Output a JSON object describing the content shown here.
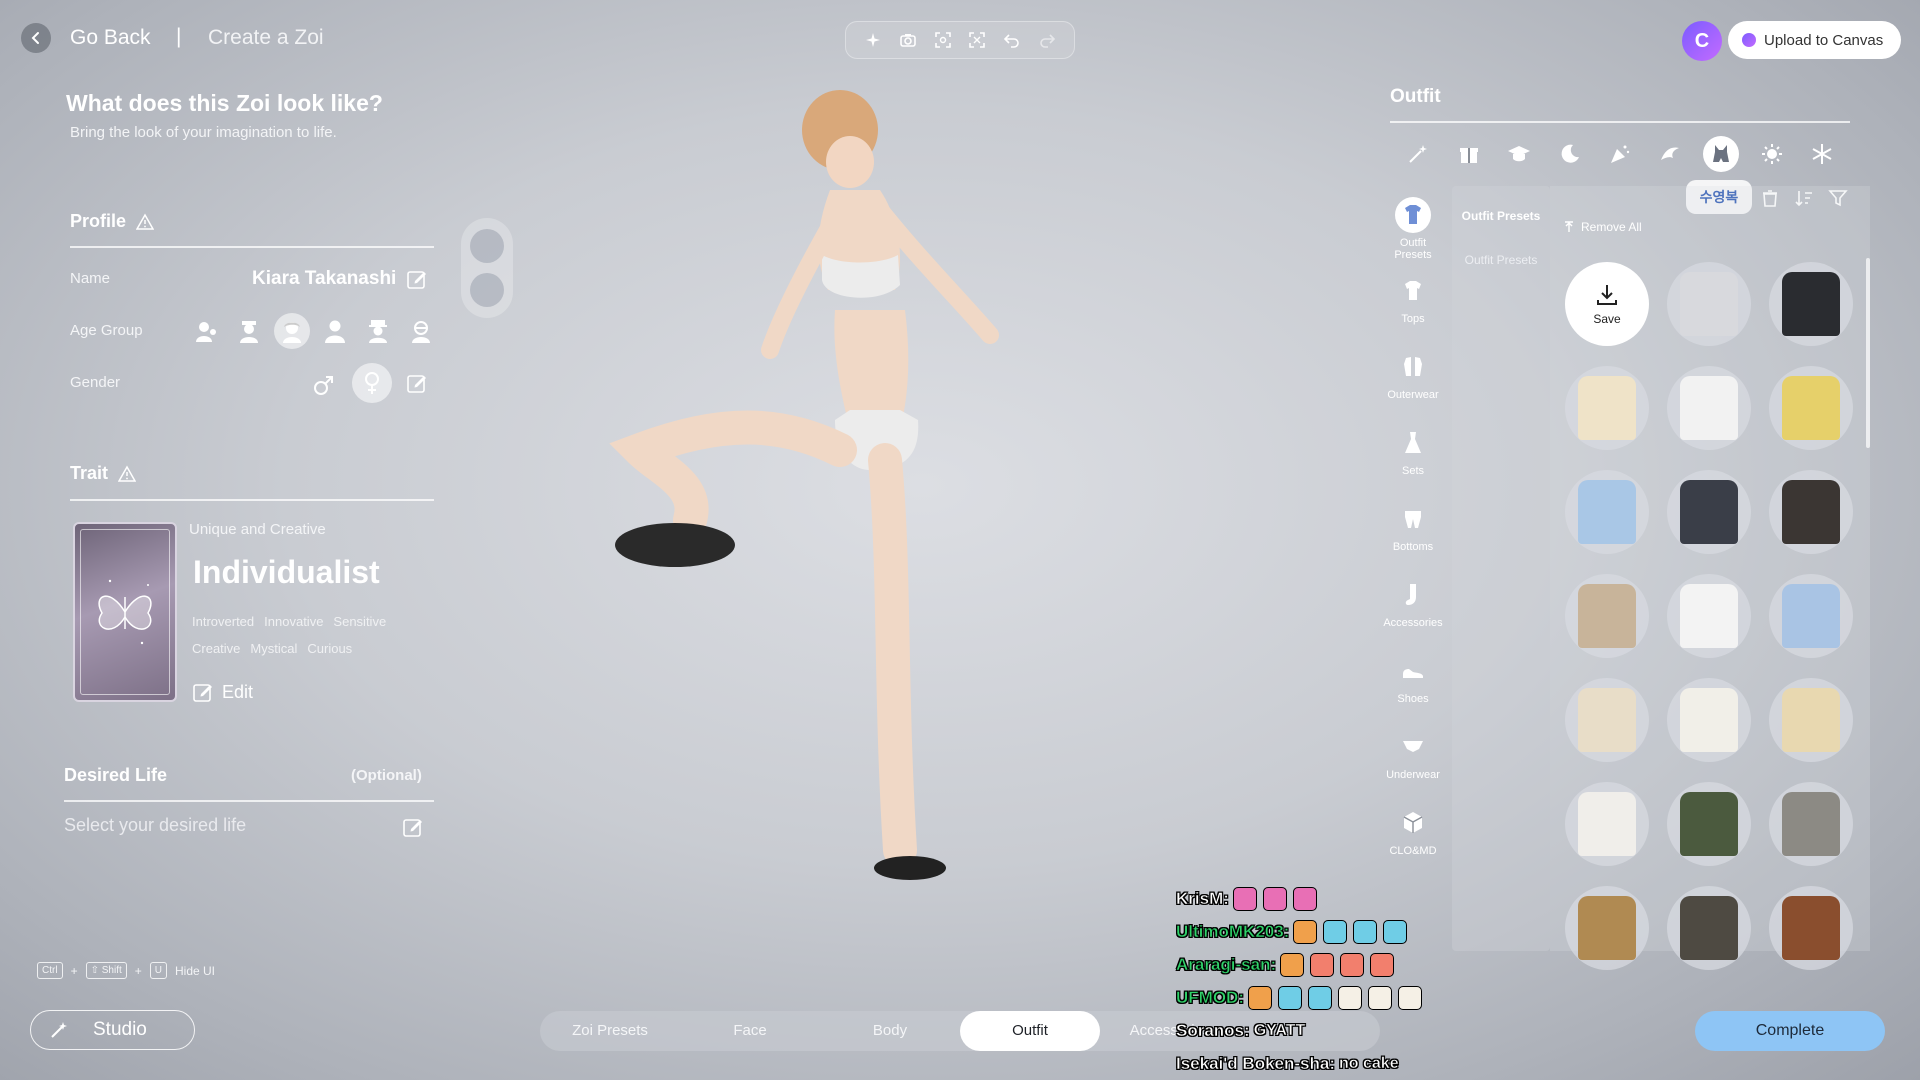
{
  "header": {
    "back_label": "Go Back",
    "separator": "|",
    "page_title": "Create a Zoi",
    "upload_label": "Upload to Canvas",
    "canvas_logo": "C"
  },
  "toolbar": {
    "tools": [
      "sparkle-icon",
      "camera-icon",
      "focus-icon",
      "zoom-focus-icon",
      "undo-icon",
      "redo-icon"
    ]
  },
  "left": {
    "heading": "What does this Zoi look like?",
    "subheading": "Bring the look of your imagination to life.",
    "profile": {
      "title": "Profile",
      "name_label": "Name",
      "name_value": "Kiara Takanashi",
      "age_label": "Age Group",
      "age_selected_index": 2,
      "gender_label": "Gender",
      "gender_selected": "female"
    },
    "trait": {
      "title": "Trait",
      "category": "Unique and Creative",
      "name": "Individualist",
      "tags_row1": [
        "Introverted",
        "Innovative",
        "Sensitive"
      ],
      "tags_row2": [
        "Creative",
        "Mystical",
        "Curious"
      ],
      "edit_label": "Edit"
    },
    "desired_life": {
      "title": "Desired Life",
      "optional": "(Optional)",
      "placeholder": "Select your desired life"
    },
    "hotkeys": {
      "key1": "Ctrl",
      "plus": "+",
      "key2": "⇧ Shift",
      "key3": "U",
      "action": "Hide UI"
    },
    "studio_label": "Studio"
  },
  "bottom_tabs": {
    "tabs": [
      "Zoi Presets",
      "Face",
      "Body",
      "Outfit",
      "Accessories"
    ],
    "active_index": 3
  },
  "complete_label": "Complete",
  "chat": [
    {
      "name": "KrisM:",
      "color": "#ffffff",
      "msg": "",
      "emotes": [
        "#e86fb5",
        "#e86fb5",
        "#e86fb5"
      ]
    },
    {
      "name": "UltimoMK203:",
      "color": "#2fd36a",
      "msg": "",
      "emotes": [
        "#f0a04b",
        "#6fcde6",
        "#6fcde6",
        "#6fcde6"
      ]
    },
    {
      "name": "Araragi-san:",
      "color": "#2fd36a",
      "msg": "",
      "emotes": [
        "#f0a04b",
        "#f27f6d",
        "#f27f6d",
        "#f27f6d"
      ]
    },
    {
      "name": "UFMOD:",
      "color": "#2fd36a",
      "msg": "",
      "emotes": [
        "#f0a04b",
        "#6fcde6",
        "#6fcde6",
        "#f5f0e6",
        "#f5f0e6",
        "#f5f0e6"
      ]
    },
    {
      "name": "Soranos:",
      "color": "#ffffff",
      "msg": "GYATT",
      "emotes": []
    },
    {
      "name": "Isekai'd Boken-sha:",
      "color": "#ffffff",
      "msg": "no cake",
      "emotes": []
    }
  ],
  "right": {
    "title": "Outfit",
    "themes": [
      "magic-wand-icon",
      "gift-icon",
      "graduation-cap-icon",
      "moon-icon",
      "party-icon",
      "wave-icon",
      "swimsuit-icon",
      "sun-icon",
      "snowflake-icon"
    ],
    "active_theme_index": 6,
    "tooltip": "수영복",
    "tools": [
      "trash-icon",
      "sort-icon",
      "filter-icon"
    ],
    "categories": [
      {
        "label": "Outfit Presets",
        "icon": "outfit-presets-icon"
      },
      {
        "label": "Tops",
        "icon": "tshirt-icon"
      },
      {
        "label": "Outerwear",
        "icon": "jacket-icon"
      },
      {
        "label": "Sets",
        "icon": "dress-icon"
      },
      {
        "label": "Bottoms",
        "icon": "pants-icon"
      },
      {
        "label": "Accessories",
        "icon": "sock-icon"
      },
      {
        "label": "Shoes",
        "icon": "shoe-icon"
      },
      {
        "label": "Underwear",
        "icon": "underwear-icon"
      },
      {
        "label": "CLO&MD",
        "icon": "cube-icon"
      }
    ],
    "active_category_index": 0,
    "presets": [
      "Outfit Presets",
      "Outfit Presets"
    ],
    "remove_all": "Remove All",
    "save_label": "Save",
    "items": [
      "#d8d9dd",
      "#2a2c30",
      "#efe3c8",
      "#f2f2f2",
      "#e6d06a",
      "#a9c7e6",
      "#3a3e48",
      "#3b3633",
      "#c8b49a",
      "#f3f3f3",
      "#a9c4e4",
      "#e8ddc8",
      "#f1efe8",
      "#e8d8b0",
      "#f0eeea",
      "#4b5a3e",
      "#8c8a84",
      "#b08a52",
      "#4e4a42",
      "#8a4e2e"
    ]
  }
}
